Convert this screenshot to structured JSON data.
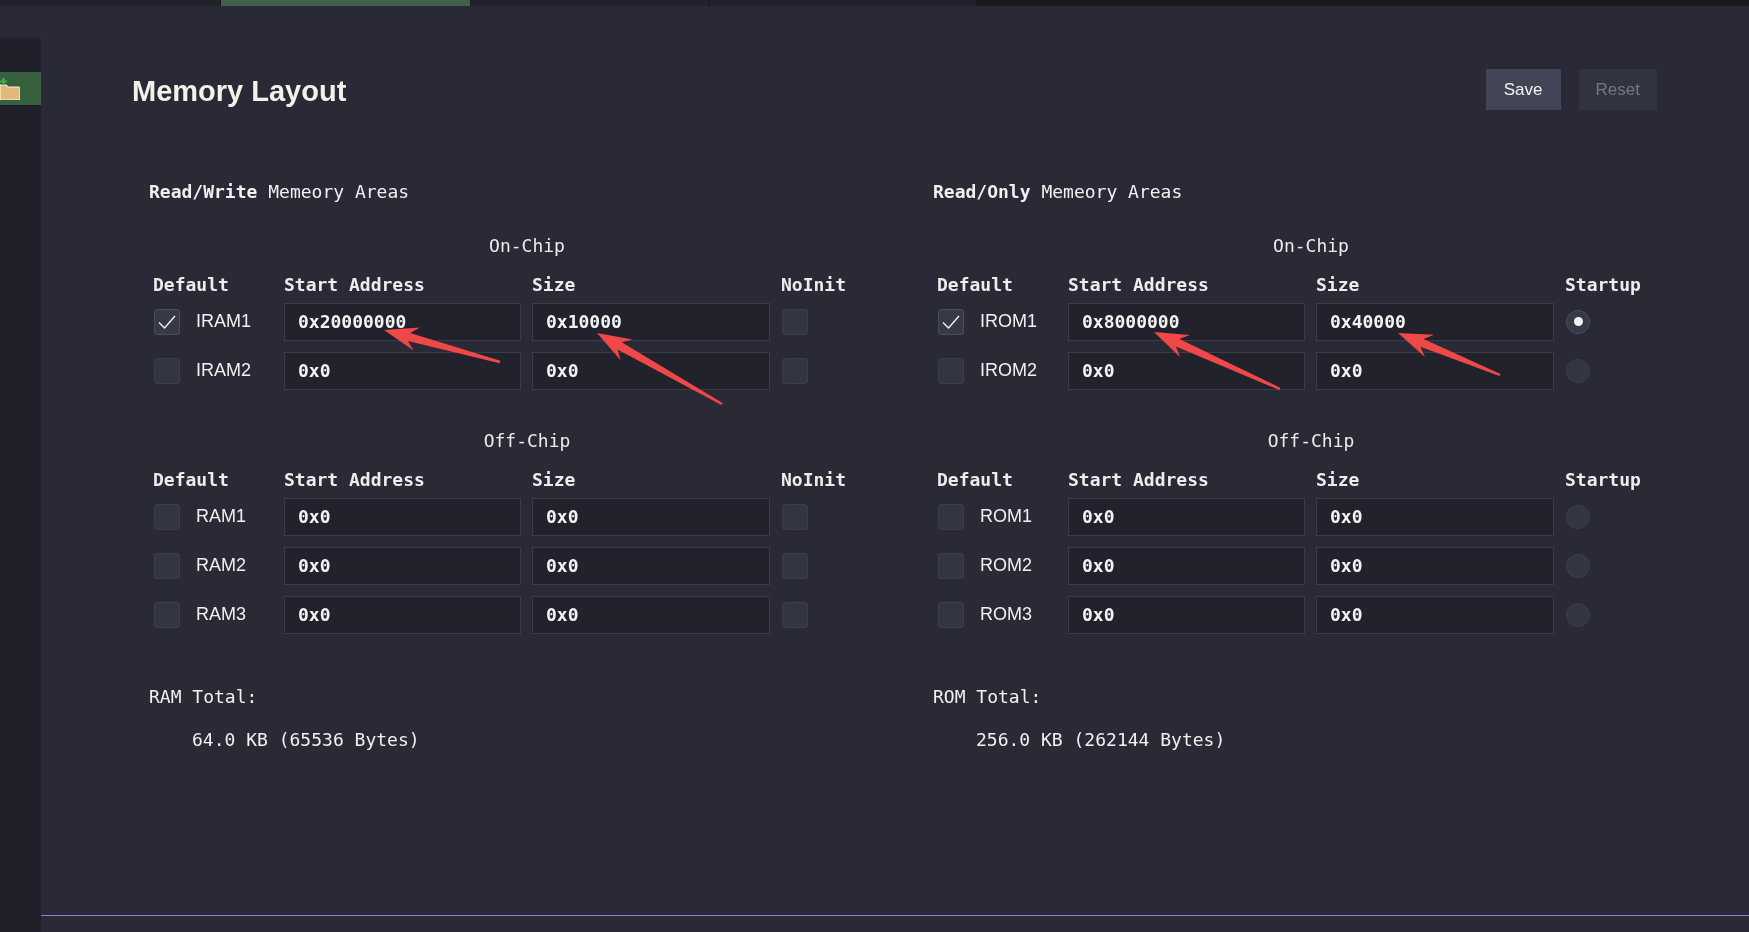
{
  "tab_bar": {
    "tabs": [
      {
        "selected": false
      },
      {
        "selected": true
      },
      {
        "selected": false
      },
      {
        "selected": false
      }
    ]
  },
  "sidebar": {
    "items": [
      {
        "selected": true
      }
    ]
  },
  "title": "Memory Layout",
  "buttons": [
    {
      "label": "Save",
      "disabled": false
    },
    {
      "label": "Reset",
      "disabled": true
    }
  ],
  "sections": [
    {
      "kind": "checkbox",
      "heading": "**Read/Write** Memeory Areas",
      "groups": [
        {
          "title": "On-Chip",
          "columns": [
            "Default",
            "Start Address",
            "Size",
            "NoInit"
          ],
          "rows": [
            {
              "name": "IRAM1",
              "default": true,
              "start_address": "0x20000000",
              "size": "0x10000",
              "checked": false
            },
            {
              "name": "IRAM2",
              "default": false,
              "start_address": "0x0",
              "size": "0x0",
              "checked": false
            }
          ]
        },
        {
          "title": "Off-Chip",
          "columns": [
            "Default",
            "Start Address",
            "Size",
            "NoInit"
          ],
          "rows": [
            {
              "name": "RAM1",
              "default": false,
              "start_address": "0x0",
              "size": "0x0",
              "checked": false
            },
            {
              "name": "RAM2",
              "default": false,
              "start_address": "0x0",
              "size": "0x0",
              "checked": false
            },
            {
              "name": "RAM3",
              "default": false,
              "start_address": "0x0",
              "size": "0x0",
              "checked": false
            }
          ]
        }
      ],
      "total_label": "RAM Total:",
      "total_value": "64.0 KB (65536 Bytes)"
    },
    {
      "kind": "radio",
      "heading": "**Read/Only** Memeory Areas",
      "groups": [
        {
          "title": "On-Chip",
          "columns": [
            "Default",
            "Start Address",
            "Size",
            "Startup"
          ],
          "rows": [
            {
              "name": "IROM1",
              "default": true,
              "start_address": "0x8000000",
              "size": "0x40000",
              "selected": true
            },
            {
              "name": "IROM2",
              "default": false,
              "start_address": "0x0",
              "size": "0x0",
              "selected": false
            }
          ]
        },
        {
          "title": "Off-Chip",
          "columns": [
            "Default",
            "Start Address",
            "Size",
            "Startup"
          ],
          "rows": [
            {
              "name": "ROM1",
              "default": false,
              "start_address": "0x0",
              "size": "0x0",
              "selected": false
            },
            {
              "name": "ROM2",
              "default": false,
              "start_address": "0x0",
              "size": "0x0",
              "selected": false
            },
            {
              "name": "ROM3",
              "default": false,
              "start_address": "0x0",
              "size": "0x0",
              "selected": false
            }
          ]
        }
      ],
      "total_label": "ROM Total:",
      "total_value": "256.0 KB (262144 Bytes)"
    }
  ]
}
